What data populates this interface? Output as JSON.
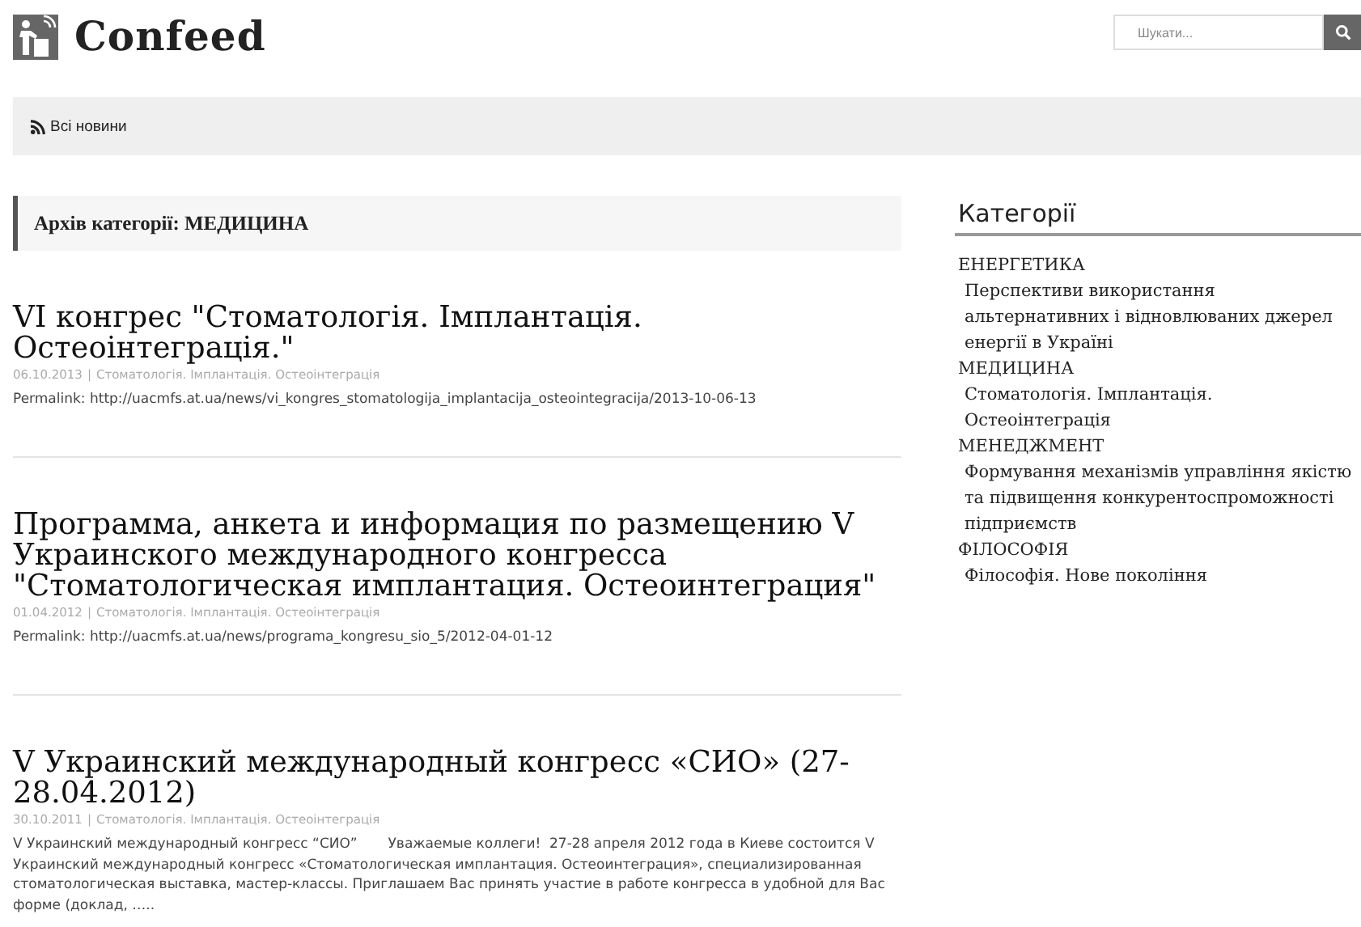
{
  "site": {
    "title": "Confeed"
  },
  "search": {
    "placeholder": "Шукати..."
  },
  "nav": {
    "items": [
      {
        "label": "Всі новини"
      }
    ]
  },
  "archive": {
    "heading": "Архів категорії: МЕДИЦИНА"
  },
  "posts": [
    {
      "title": "VI конгрес \"Стоматологія. Імплантація. Остеоінтеграція.\"",
      "date": "06.10.2013",
      "separator": "|",
      "category": "Стоматологія. Імплантація. Остеоінтеграція",
      "permalink": "Permalink: http://uacmfs.at.ua/news/vi_kongres_stomatologija_implantacija_osteointegracija/2013-10-06-13"
    },
    {
      "title": "Программа, анкета и информация по размещению V Украинского международного конгресса \"Стоматологическая имплантация. Остеоинтеграция\"",
      "date": "01.04.2012",
      "separator": "|",
      "category": "Стоматологія. Імплантація. Остеоінтеграція",
      "permalink": "Permalink: http://uacmfs.at.ua/news/programa_kongresu_sio_5/2012-04-01-12"
    },
    {
      "title": "V Украинский международный конгресс «СИО» (27-28.04.2012)",
      "date": "30.10.2011",
      "separator": "|",
      "category": "Стоматологія. Імплантація. Остеоінтеграція",
      "excerpt": "V Украинский международный конгресс “СИО”       Уважаемые коллеги!  27-28 апреля 2012 года в Киеве состоится V Украинский международный конгресс «Стоматологическая имплантация. Остеоинтеграция», специализированная стоматологическая выставка, мастер-классы. Приглашаем Вас принять участие в работе конгресса в удобной для Вас форме (доклад, ….."
    }
  ],
  "sidebar": {
    "heading": "Категорії",
    "categories": [
      {
        "name": "ЕНЕРГЕТИКА",
        "children": [
          {
            "name": "Перспективи використання альтернативних і відновлюваних джерел енергії в Україні"
          }
        ]
      },
      {
        "name": "МЕДИЦИНА",
        "children": [
          {
            "name": "Стоматологія. Імплантація. Остеоінтеграція"
          }
        ]
      },
      {
        "name": "МЕНЕДЖМЕНТ",
        "children": [
          {
            "name": "Формування механізмів управління якістю та підвищення конкурентоспроможності підприємств"
          }
        ]
      },
      {
        "name": "ФІЛОСОФІЯ",
        "children": [
          {
            "name": "Філософія. Нове покоління"
          }
        ]
      }
    ]
  }
}
